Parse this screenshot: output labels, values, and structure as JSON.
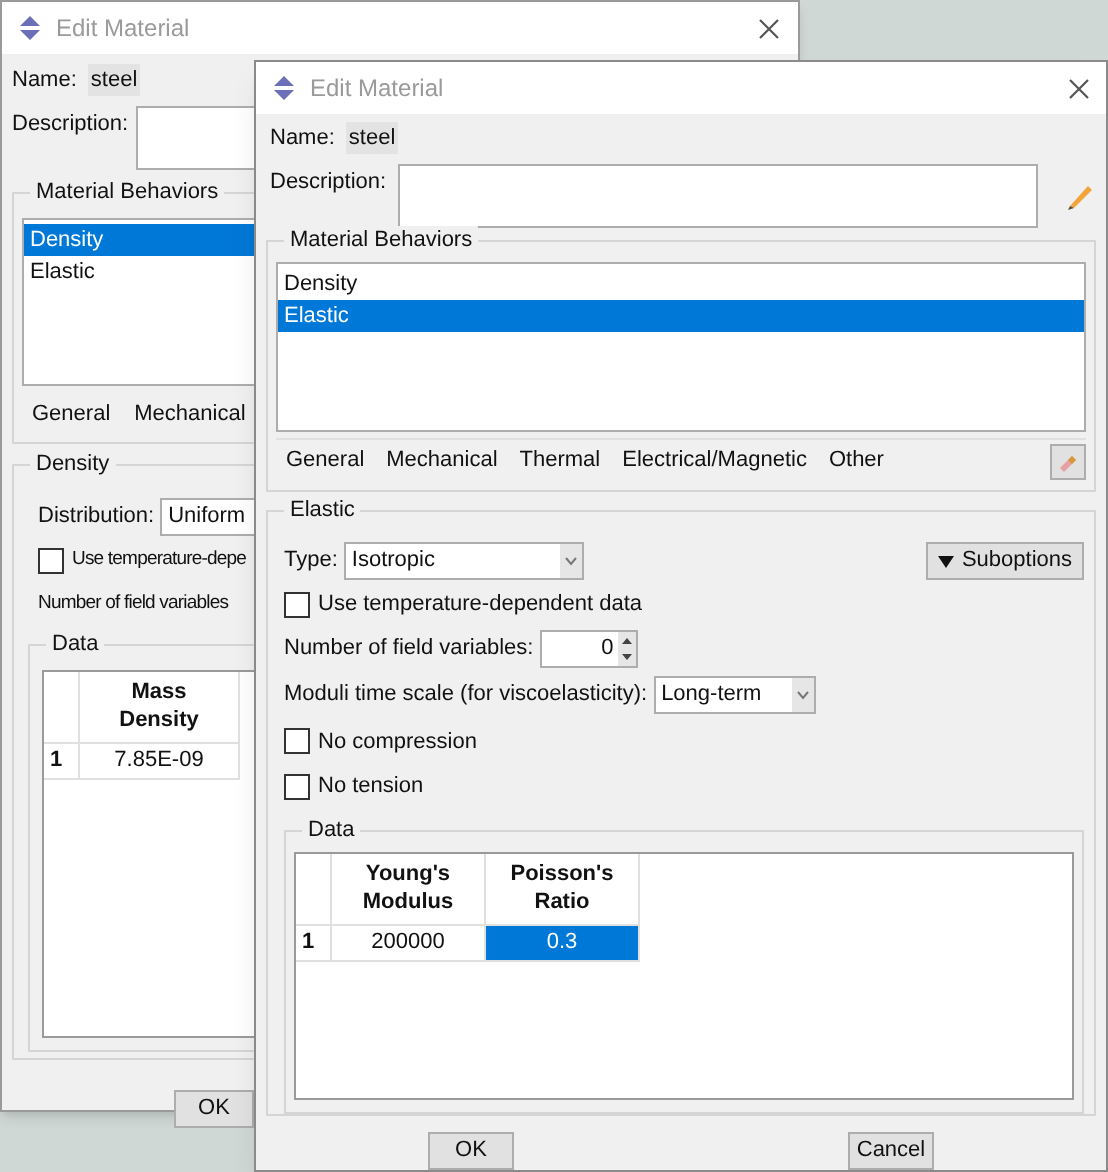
{
  "back_window": {
    "title": "Edit Material",
    "name_label": "Name:",
    "name_value": "steel",
    "description_label": "Description:",
    "behaviors_title": "Material Behaviors",
    "behaviors": [
      {
        "label": "Density",
        "selected": true
      },
      {
        "label": "Elastic",
        "selected": false
      }
    ],
    "tabs": [
      "General",
      "Mechanical"
    ],
    "section": {
      "title": "Density",
      "distribution_label": "Distribution:",
      "distribution_value": "Uniform",
      "temperature_checkbox": {
        "label": "Use temperature-depe",
        "checked": false
      },
      "field_variables_label": "Number of field variables",
      "data_title": "Data",
      "table": {
        "columns": [
          "Mass Density"
        ],
        "rows": [
          {
            "index": "1",
            "cells": [
              {
                "text": "7.85E-09",
                "selected": false
              }
            ]
          }
        ]
      }
    },
    "buttons": [
      "OK"
    ]
  },
  "front_window": {
    "title": "Edit Material",
    "name_label": "Name:",
    "name_value": "steel",
    "description_label": "Description:",
    "behaviors_title": "Material Behaviors",
    "behaviors": [
      {
        "label": "Density",
        "selected": false
      },
      {
        "label": "Elastic",
        "selected": true
      }
    ],
    "tabs": [
      "General",
      "Mechanical",
      "Thermal",
      "Electrical/Magnetic",
      "Other"
    ],
    "section": {
      "title": "Elastic",
      "type_label": "Type:",
      "type_value": "Isotropic",
      "suboptions": "Suboptions",
      "temperature_checkbox": {
        "label": "Use temperature-dependent data",
        "checked": false
      },
      "field_variables_label": "Number of field variables:",
      "field_variables_value": "0",
      "time_scale_label": "Moduli time scale (for viscoelasticity):",
      "time_scale_value": "Long-term",
      "options": [
        {
          "label": "No compression",
          "checked": false
        },
        {
          "label": "No tension",
          "checked": false
        }
      ],
      "data_title": "Data",
      "table": {
        "columns": [
          "Young's Modulus",
          "Poisson's Ratio"
        ],
        "rows": [
          {
            "index": "1",
            "cells": [
              {
                "text": "200000",
                "selected": false
              },
              {
                "text": "0.3",
                "selected": true
              }
            ]
          }
        ]
      }
    },
    "buttons": [
      "OK",
      "Cancel"
    ]
  }
}
